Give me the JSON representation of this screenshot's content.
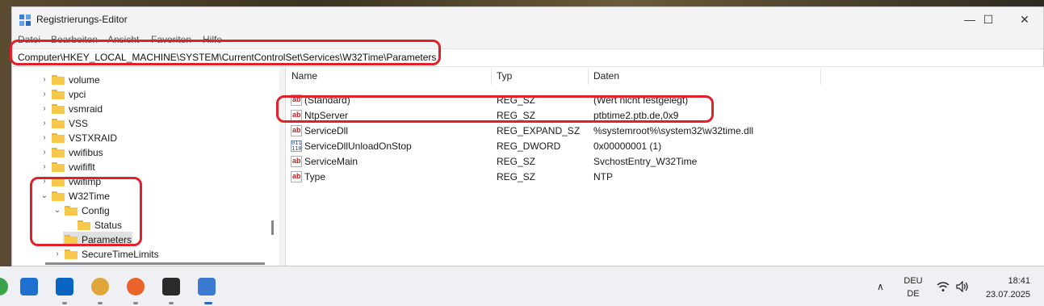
{
  "window": {
    "title": "Registrierungs-Editor",
    "controls": {
      "minimize": "—",
      "maximize": "☐",
      "close": "✕"
    }
  },
  "menu": [
    "Datei",
    "Bearbeiten",
    "Ansicht",
    "Favoriten",
    "Hilfe"
  ],
  "address": "Computer\\HKEY_LOCAL_MACHINE\\SYSTEM\\CurrentControlSet\\Services\\W32Time\\Parameters",
  "tree": {
    "items": [
      {
        "label": "volume",
        "expander": "›"
      },
      {
        "label": "vpci",
        "expander": "›"
      },
      {
        "label": "vsmraid",
        "expander": "›"
      },
      {
        "label": "VSS",
        "expander": "›"
      },
      {
        "label": "VSTXRAID",
        "expander": "›"
      },
      {
        "label": "vwifibus",
        "expander": "›"
      },
      {
        "label": "vwififlt",
        "expander": "›"
      },
      {
        "label": "vwifimp",
        "expander": "›"
      },
      {
        "label": "W32Time",
        "expander": "⌄"
      },
      {
        "label": "Config",
        "expander": "⌄"
      },
      {
        "label": "Status",
        "expander": ""
      },
      {
        "label": "Parameters",
        "expander": ""
      },
      {
        "label": "SecureTimeLimits",
        "expander": "›"
      }
    ]
  },
  "list": {
    "headers": {
      "name": "Name",
      "type": "Typ",
      "data": "Daten"
    },
    "rows": [
      {
        "icon": "string-value-icon",
        "name": "(Standard)",
        "type": "REG_SZ",
        "data": "(Wert nicht festgelegt)"
      },
      {
        "icon": "string-value-icon",
        "name": "NtpServer",
        "type": "REG_SZ",
        "data": "ptbtime2.ptb.de,0x9"
      },
      {
        "icon": "string-value-icon",
        "name": "ServiceDll",
        "type": "REG_EXPAND_SZ",
        "data": "%systemroot%\\system32\\w32time.dll"
      },
      {
        "icon": "binary-value-icon",
        "name": "ServiceDllUnloadOnStop",
        "type": "REG_DWORD",
        "data": "0x00000001 (1)"
      },
      {
        "icon": "string-value-icon",
        "name": "ServiceMain",
        "type": "REG_SZ",
        "data": "SvchostEntry_W32Time"
      },
      {
        "icon": "string-value-icon",
        "name": "Type",
        "type": "REG_SZ",
        "data": "NTP"
      }
    ]
  },
  "taskbar": {
    "language": "DEU",
    "region": "DE",
    "time": "18:41",
    "date": "23.07.2025",
    "apps": [
      "start-icon",
      "outlook-icon",
      "app-icon",
      "firefox-icon",
      "terminal-icon",
      "regedit-icon"
    ]
  },
  "colors": {
    "highlight": "#e0202a",
    "folder": "#f6c94d",
    "selection": "#e0e0e0"
  }
}
